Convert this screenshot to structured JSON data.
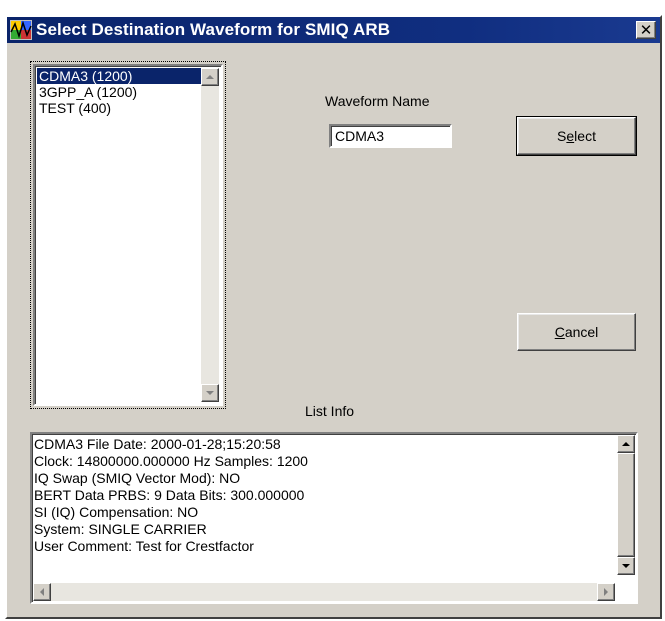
{
  "window": {
    "title": "Select Destination Waveform for SMIQ ARB",
    "close_glyph": "✕"
  },
  "waveform_list": {
    "items": [
      {
        "label": "CDMA3 (1200)",
        "selected": true
      },
      {
        "label": "3GPP_A (1200)",
        "selected": false
      },
      {
        "label": "TEST (400)",
        "selected": false
      }
    ]
  },
  "waveform_name": {
    "label": "Waveform Name",
    "value": "CDMA3"
  },
  "buttons": {
    "select_label_pre": "S",
    "select_label_ul": "e",
    "select_label_post": "lect",
    "cancel_label_ul": "C",
    "cancel_label_post": "ancel"
  },
  "list_info": {
    "label": "List Info",
    "lines": [
      "CDMA3  File Date:  2000-01-28;15:20:58",
      "Clock:  14800000.000000 Hz    Samples: 1200",
      "IQ Swap (SMIQ Vector Mod):  NO",
      "BERT Data PRBS:  9    Data Bits:  300.000000",
      "SI (IQ) Compensation:  NO",
      "System:  SINGLE CARRIER",
      "User Comment:  Test for Crestfactor"
    ]
  },
  "icons": {
    "app": "waveform-app-icon",
    "close": "close-icon"
  }
}
